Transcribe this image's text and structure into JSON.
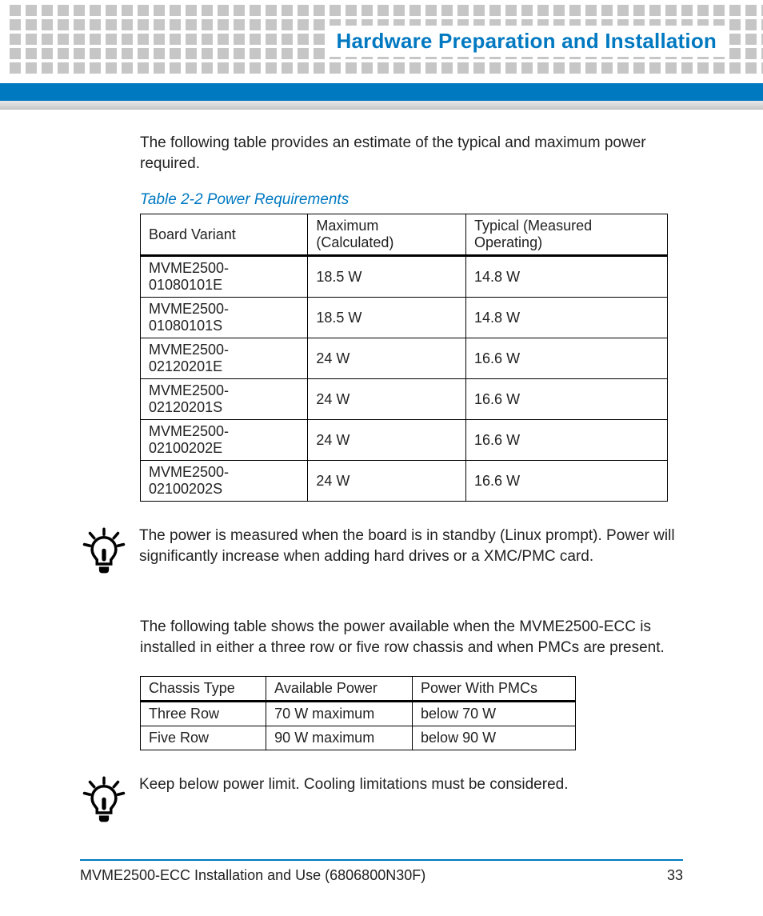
{
  "header": {
    "title": "Hardware Preparation and Installation"
  },
  "intro_para": "The following table provides an estimate of the typical and maximum power required.",
  "table1": {
    "caption": "Table 2-2 Power Requirements",
    "headers": [
      "Board Variant",
      "Maximum (Calculated)",
      "Typical (Measured Operating)"
    ],
    "rows": [
      [
        "MVME2500-01080101E",
        "18.5 W",
        "14.8 W"
      ],
      [
        "MVME2500-01080101S",
        "18.5 W",
        "14.8 W"
      ],
      [
        "MVME2500-02120201E",
        "24 W",
        "16.6 W"
      ],
      [
        "MVME2500-02120201S",
        "24 W",
        "16.6 W"
      ],
      [
        "MVME2500-02100202E",
        "24 W",
        "16.6 W"
      ],
      [
        "MVME2500-02100202S",
        "24 W",
        "16.6 W"
      ]
    ]
  },
  "note1": "The power is measured when the board is in standby (Linux prompt). Power will significantly increase when adding hard drives or a XMC/PMC card.",
  "mid_para": "The following table shows the power available when the MVME2500-ECC is installed in either a three row or five row chassis and when PMCs are present.",
  "table2": {
    "headers": [
      "Chassis Type",
      "Available Power",
      "Power With PMCs"
    ],
    "rows": [
      [
        "Three Row",
        "70 W maximum",
        "below 70 W"
      ],
      [
        "Five Row",
        "90 W maximum",
        "below 90 W"
      ]
    ]
  },
  "note2": "Keep below power limit. Cooling limitations must be considered.",
  "footer": {
    "doc": "MVME2500-ECC Installation and Use (6806800N30F)",
    "page": "33"
  }
}
